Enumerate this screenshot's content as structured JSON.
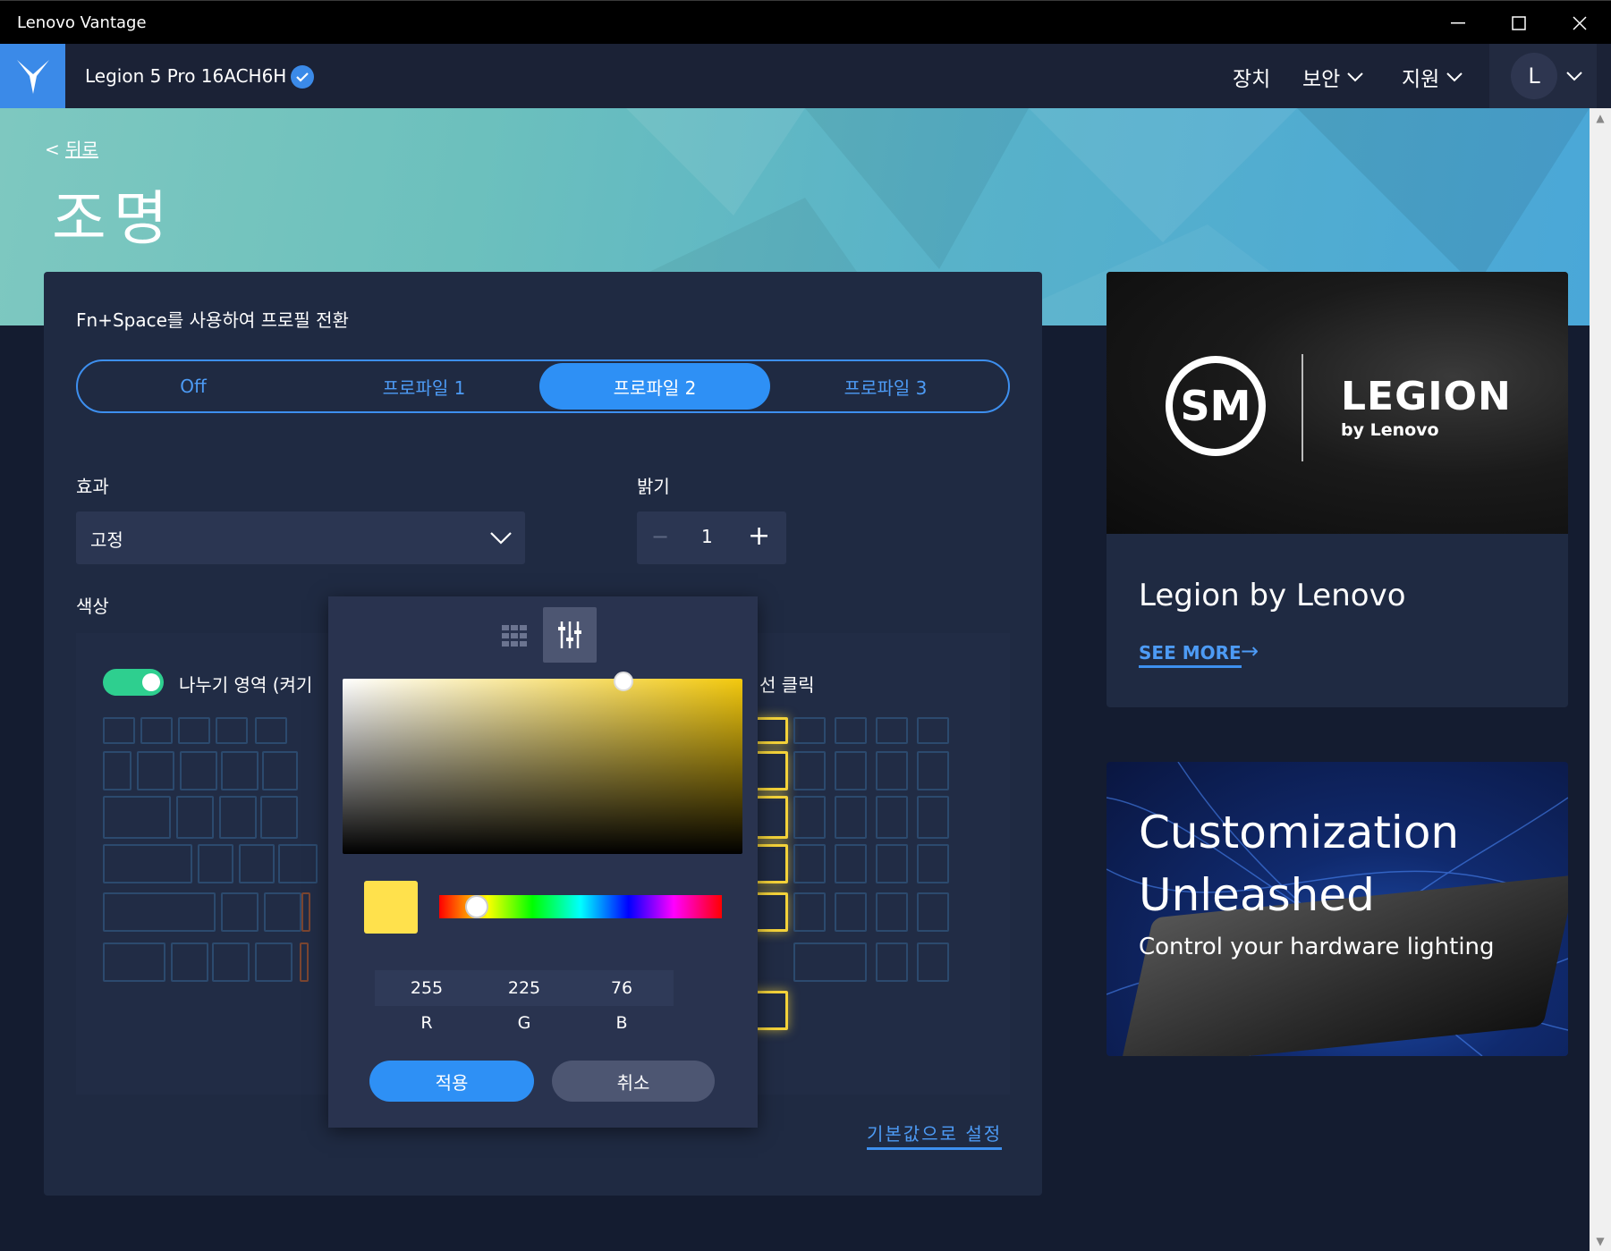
{
  "window": {
    "title": "Lenovo Vantage",
    "minimize_icon": "minimize-icon",
    "maximize_icon": "maximize-icon",
    "close_icon": "close-icon"
  },
  "header": {
    "device_name": "Legion 5 Pro 16ACH6H",
    "nav": [
      "장치",
      "보안",
      "지원"
    ],
    "avatar_initial": "L",
    "brand_color": "#3b8ae8"
  },
  "banner": {
    "back_prefix": "<",
    "back_label": "뒤로",
    "page_title": "조명"
  },
  "lighting": {
    "fn_label": "Fn+Space를 사용하여 프로필 전환",
    "profiles": [
      "Off",
      "프로파일 1",
      "프로파일 2",
      "프로파일 3"
    ],
    "active_profile": "프로파일 2",
    "effect_label": "효과",
    "effect_value": "고정",
    "brightness_label": "밝기",
    "brightness_value": "1",
    "color_label": "색상",
    "toggle_label": "나누기 영역 (켜기",
    "toggle_on": true,
    "click_label": "선 클릭",
    "reset_label": "기본값으로 설정"
  },
  "color_picker": {
    "selected_color": "#ffe14c",
    "r": "255",
    "g": "225",
    "b": "76",
    "r_label": "R",
    "g_label": "G",
    "b_label": "B",
    "apply_label": "적용",
    "cancel_label": "취소"
  },
  "cards": {
    "legion": {
      "tsm_text": "SM",
      "legion_text": "LEGION",
      "by_lenovo": "by Lenovo",
      "title": "Legion by Lenovo",
      "see_more": "SEE MORE"
    },
    "custom": {
      "line1": "Customization",
      "line2": "Unleashed",
      "sub": "Control your hardware lighting"
    }
  }
}
